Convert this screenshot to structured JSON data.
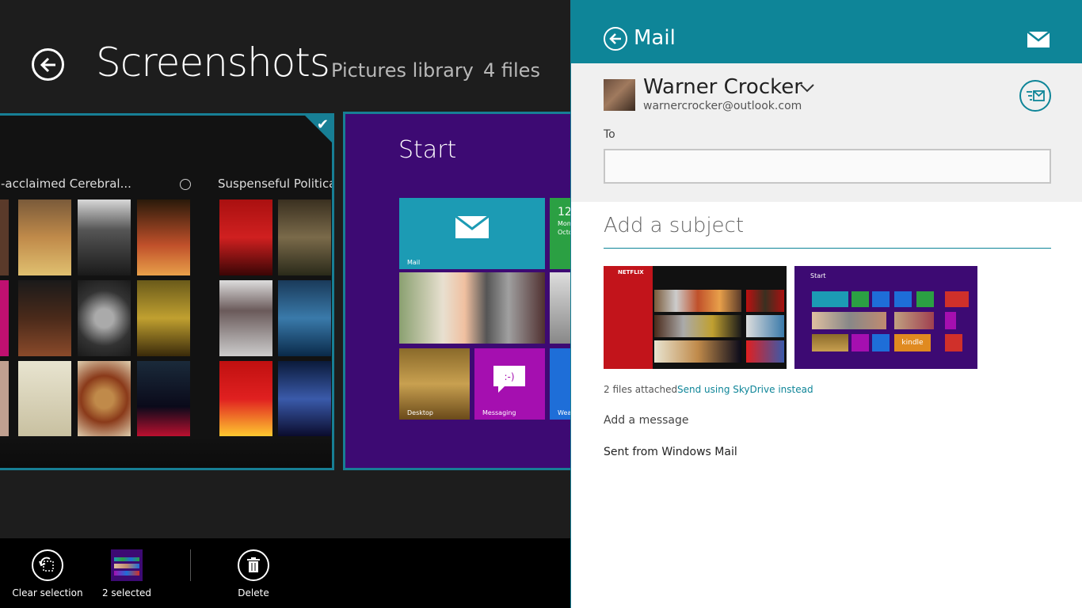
{
  "left": {
    "title": "Screenshots",
    "location": "Pictures library",
    "count": "4 files"
  },
  "thumb1": {
    "row1_title": "-acclaimed Cerebral...",
    "row2_title": "Suspenseful Political A"
  },
  "thumb2": {
    "start_label": "Start",
    "tiles": {
      "mail": "Mail",
      "desktop": "Desktop",
      "messaging": "Messaging",
      "wea": "Wea",
      "clock_text": "12",
      "clock_sub1": "Mon",
      "clock_sub2": "Octo"
    }
  },
  "appbar": {
    "clear_label": "Clear selection",
    "selected_label": "2 selected",
    "delete_label": "Delete"
  },
  "mail": {
    "title": "Mail",
    "from_name": "Warner Crocker",
    "from_email": "warnercrocker@outlook.com",
    "to_label": "To",
    "to_value": "",
    "subject_placeholder": "Add a subject",
    "attachments": [
      {
        "name": "Netflix screenshot"
      },
      {
        "name": "Start screenshot",
        "label": "Start"
      }
    ],
    "attach_info": "2 files attached",
    "attach_link": "Send using SkyDrive instead",
    "message_placeholder": "Add a message",
    "signature": "Sent from Windows Mail"
  },
  "colors": {
    "accent": "#0e8598",
    "start_bg": "#3d0a73",
    "selection": "#177f95"
  }
}
